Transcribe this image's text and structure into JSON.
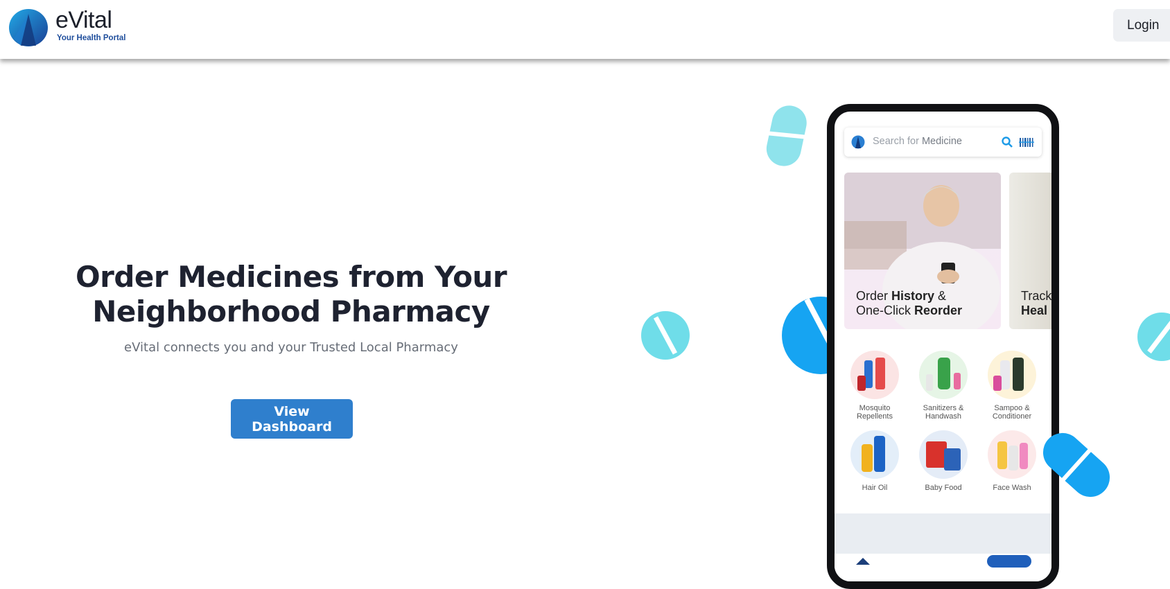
{
  "brand": {
    "name": "eVital",
    "tagline": "Your Health Portal"
  },
  "header": {
    "login_label": "Login"
  },
  "hero": {
    "title_line1": "Order Medicines from Your",
    "title_line2": "Neighborhood Pharmacy",
    "subtitle": "eVital connects you and your Trusted Local Pharmacy",
    "cta_label": "View Dashboard"
  },
  "phone": {
    "search_placeholder_prefix": "Search for",
    "search_placeholder_word": "Medicine",
    "banner1": {
      "line1_a": "Order ",
      "line1_b": "History",
      "line1_c": " &",
      "line2_a": "One-Click ",
      "line2_b": "Reorder"
    },
    "banner2": {
      "line1": "Track",
      "line2": "Heal"
    },
    "categories": [
      {
        "line1": "Mosquito",
        "line2": "Repellents"
      },
      {
        "line1": "Sanitizers &",
        "line2": "Handwash"
      },
      {
        "line1": "Sampoo &",
        "line2": "Conditioner"
      },
      {
        "line1": "Hair Oil",
        "line2": ""
      },
      {
        "line1": "Baby Food",
        "line2": ""
      },
      {
        "line1": "Face Wash",
        "line2": ""
      }
    ]
  },
  "colors": {
    "primary_button": "#2f7fcd",
    "pill_light": "#7fe0ea",
    "pill_dark": "#16a4f2",
    "brand_blue": "#1f4e9c"
  },
  "icons": [
    "evital-logo-icon",
    "search-icon",
    "barcode-icon",
    "pill-icon"
  ]
}
